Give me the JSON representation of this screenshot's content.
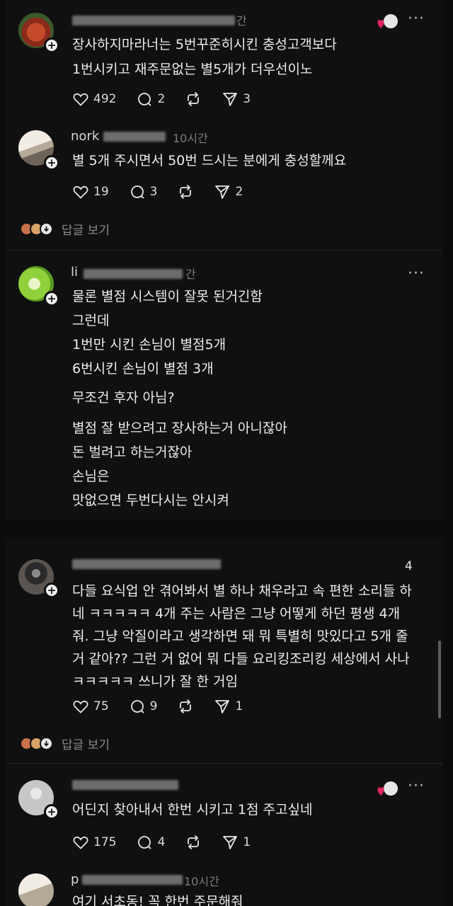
{
  "colors": {
    "background": "#101010",
    "text": "#ececec",
    "muted": "#7d7d7d",
    "heart": "#e0245e"
  },
  "posts": [
    {
      "username": "",
      "time": "간",
      "lines": [
        "장사하지마라너는 5번꾸준히시킨 충성고객보다",
        "1번시키고 재주문없는 별5개가 더우선이노"
      ],
      "likes": "492",
      "comments": "2",
      "reposts": "",
      "shares": "3"
    },
    {
      "username": "nork",
      "time": "10시간",
      "lines": [
        "별 5개 주시면서 50번 드시는 분에게 충성할께요"
      ],
      "likes": "19",
      "comments": "3",
      "reposts": "",
      "shares": "2",
      "replies_label": "답글 보기"
    },
    {
      "username": "li",
      "time": "간",
      "lines": [
        "물론 별점 시스템이 잘못 된거긴함",
        "그런데",
        "1번만 시킨 손님이 별점5개",
        "6번시킨 손님이 별점 3개",
        "무조건 후자 아님?",
        "별점 잘 받으려고 장사하는거 아니잖아",
        "돈 벌려고 하는거잖아",
        "손님은",
        "맛없으면 두번다시는 안시켜"
      ]
    },
    {
      "username": "",
      "time": "",
      "lines": [
        "다들 요식업 안 겪어봐서 별 하나 채우라고 속 편한 소리들 하",
        "네 ㅋㅋㅋㅋㅋ 4개 주는 사람은 그냥 어떻게 하던 평생 4개",
        "줘. 그냥 악질이라고 생각하면 돼 뭐 특별히 맛있다고 5개 줄",
        "거 같아?? 그런 거 없어 뭐 다들 요리킹조리킹 세상에서 사나",
        "ㅋㅋㅋㅋㅋ 쓰니가 잘 한 거임"
      ],
      "likes": "75",
      "comments": "9",
      "reposts": "",
      "shares": "1",
      "replies_label": "답글 보기",
      "badge": "4"
    },
    {
      "username": "",
      "time": "",
      "lines": [
        "어딘지 찾아내서 한번 시키고 1점 주고싶네"
      ],
      "likes": "175",
      "comments": "4",
      "reposts": "",
      "shares": "1"
    },
    {
      "username": "p",
      "time": "10시간",
      "lines": [
        "여기 서초동! 꼭 한번 주문해줘"
      ]
    }
  ]
}
